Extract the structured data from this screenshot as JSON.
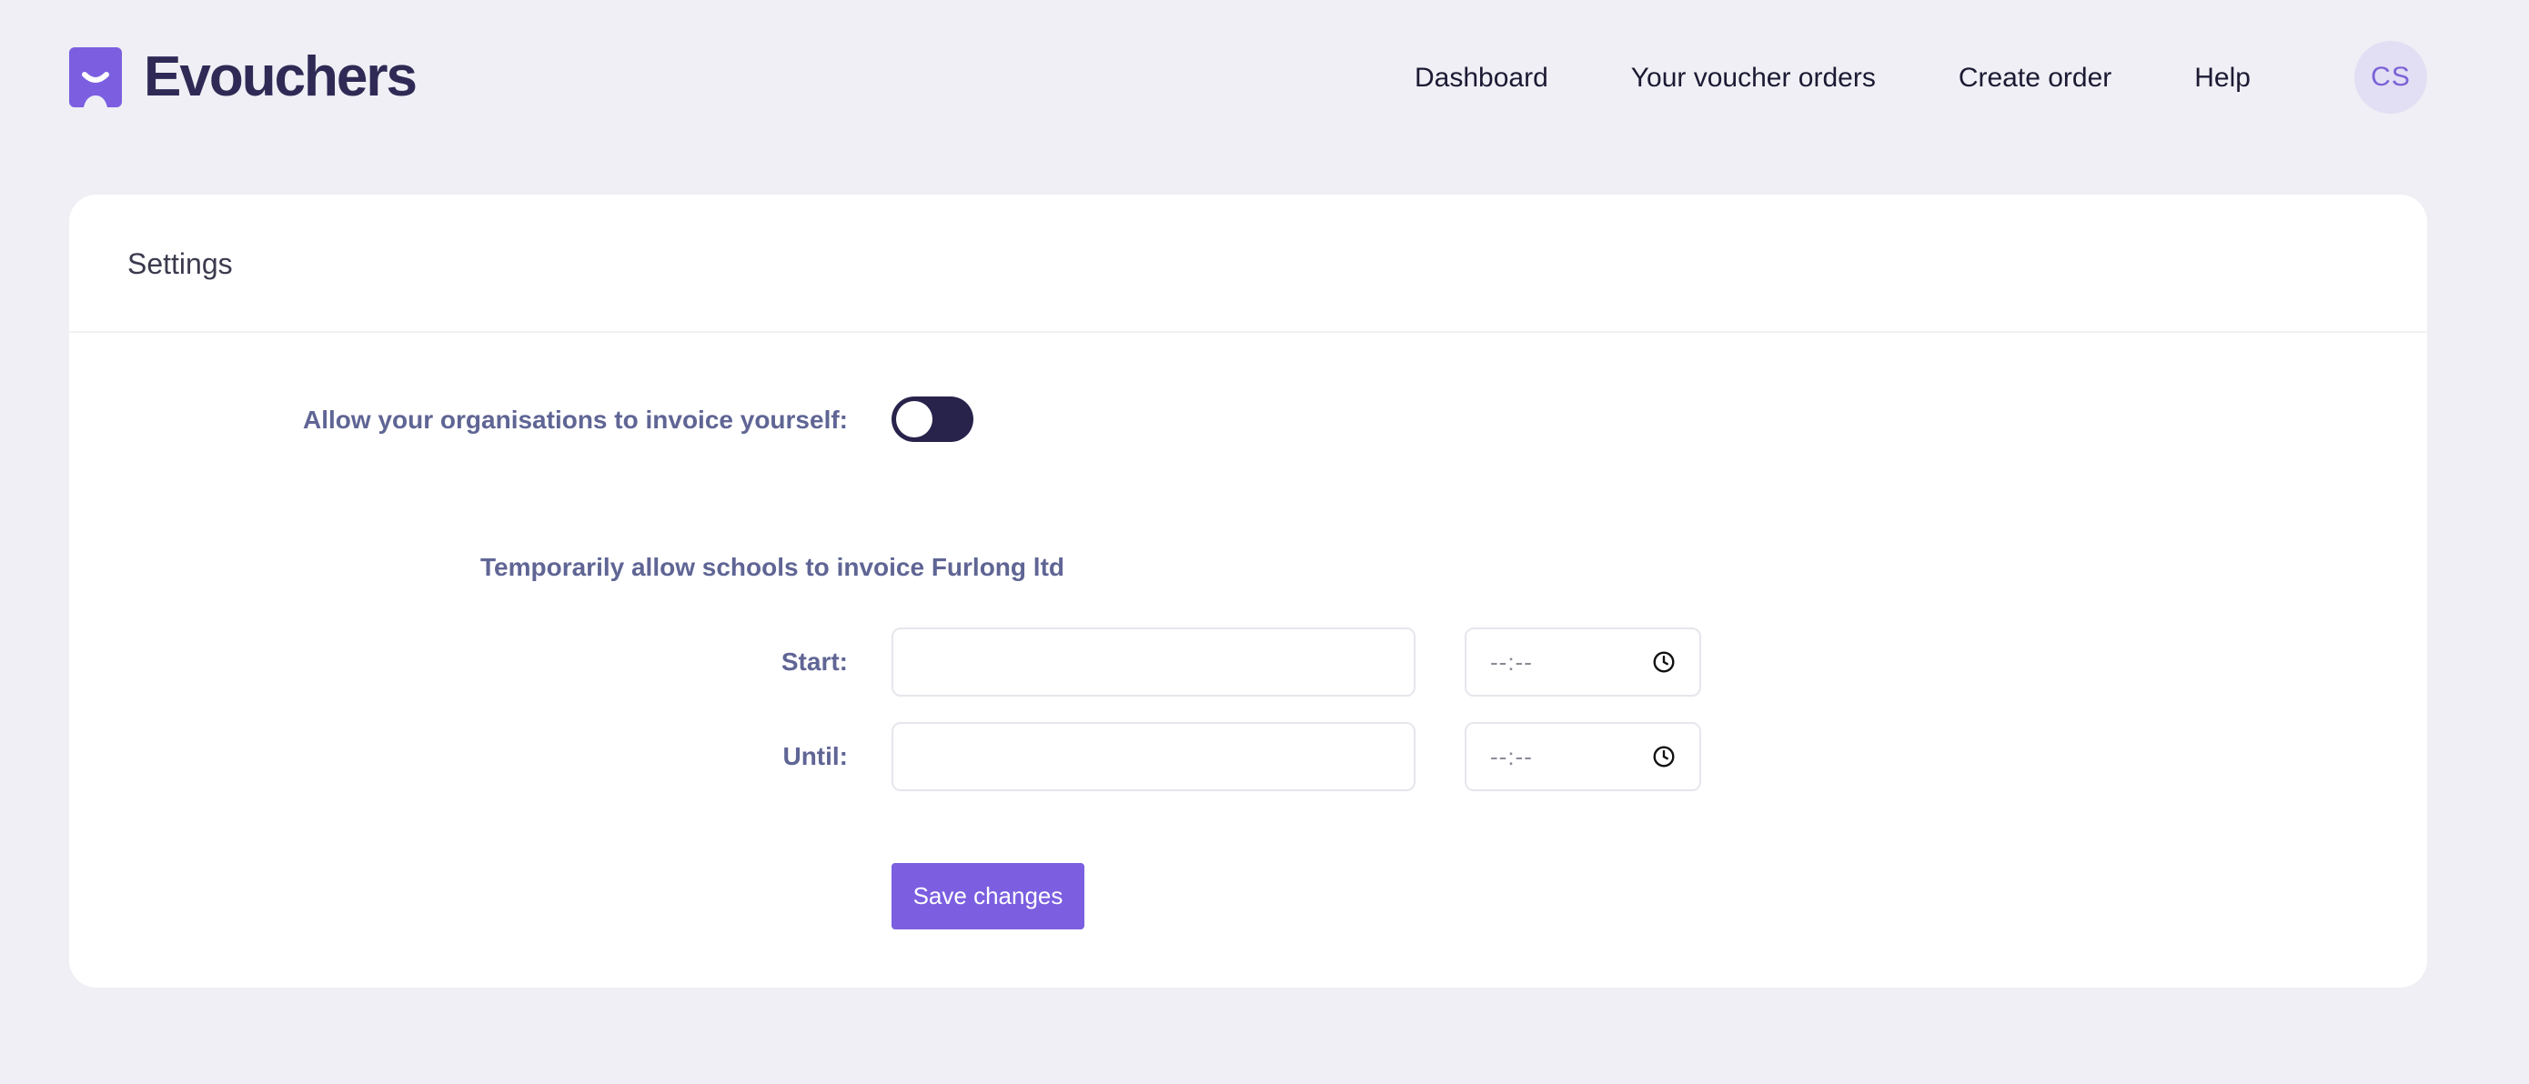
{
  "brand": {
    "name": "Evouchers",
    "accent_color": "#7b5fe0"
  },
  "nav": {
    "items": [
      {
        "label": "Dashboard"
      },
      {
        "label": "Your voucher orders"
      },
      {
        "label": "Create order"
      },
      {
        "label": "Help"
      }
    ],
    "avatar_initials": "CS"
  },
  "settings": {
    "title": "Settings",
    "invoice_toggle": {
      "label": "Allow your organisations to invoice yourself:",
      "enabled": false
    },
    "temporary": {
      "heading": "Temporarily allow schools to invoice Furlong ltd",
      "start_label": "Start:",
      "start_date": "",
      "start_time": "--:--",
      "until_label": "Until:",
      "until_date": "",
      "until_time": "--:--"
    },
    "save_label": "Save changes"
  },
  "icons": {
    "logo": "voucher-logo-icon",
    "time": "clock-icon"
  }
}
